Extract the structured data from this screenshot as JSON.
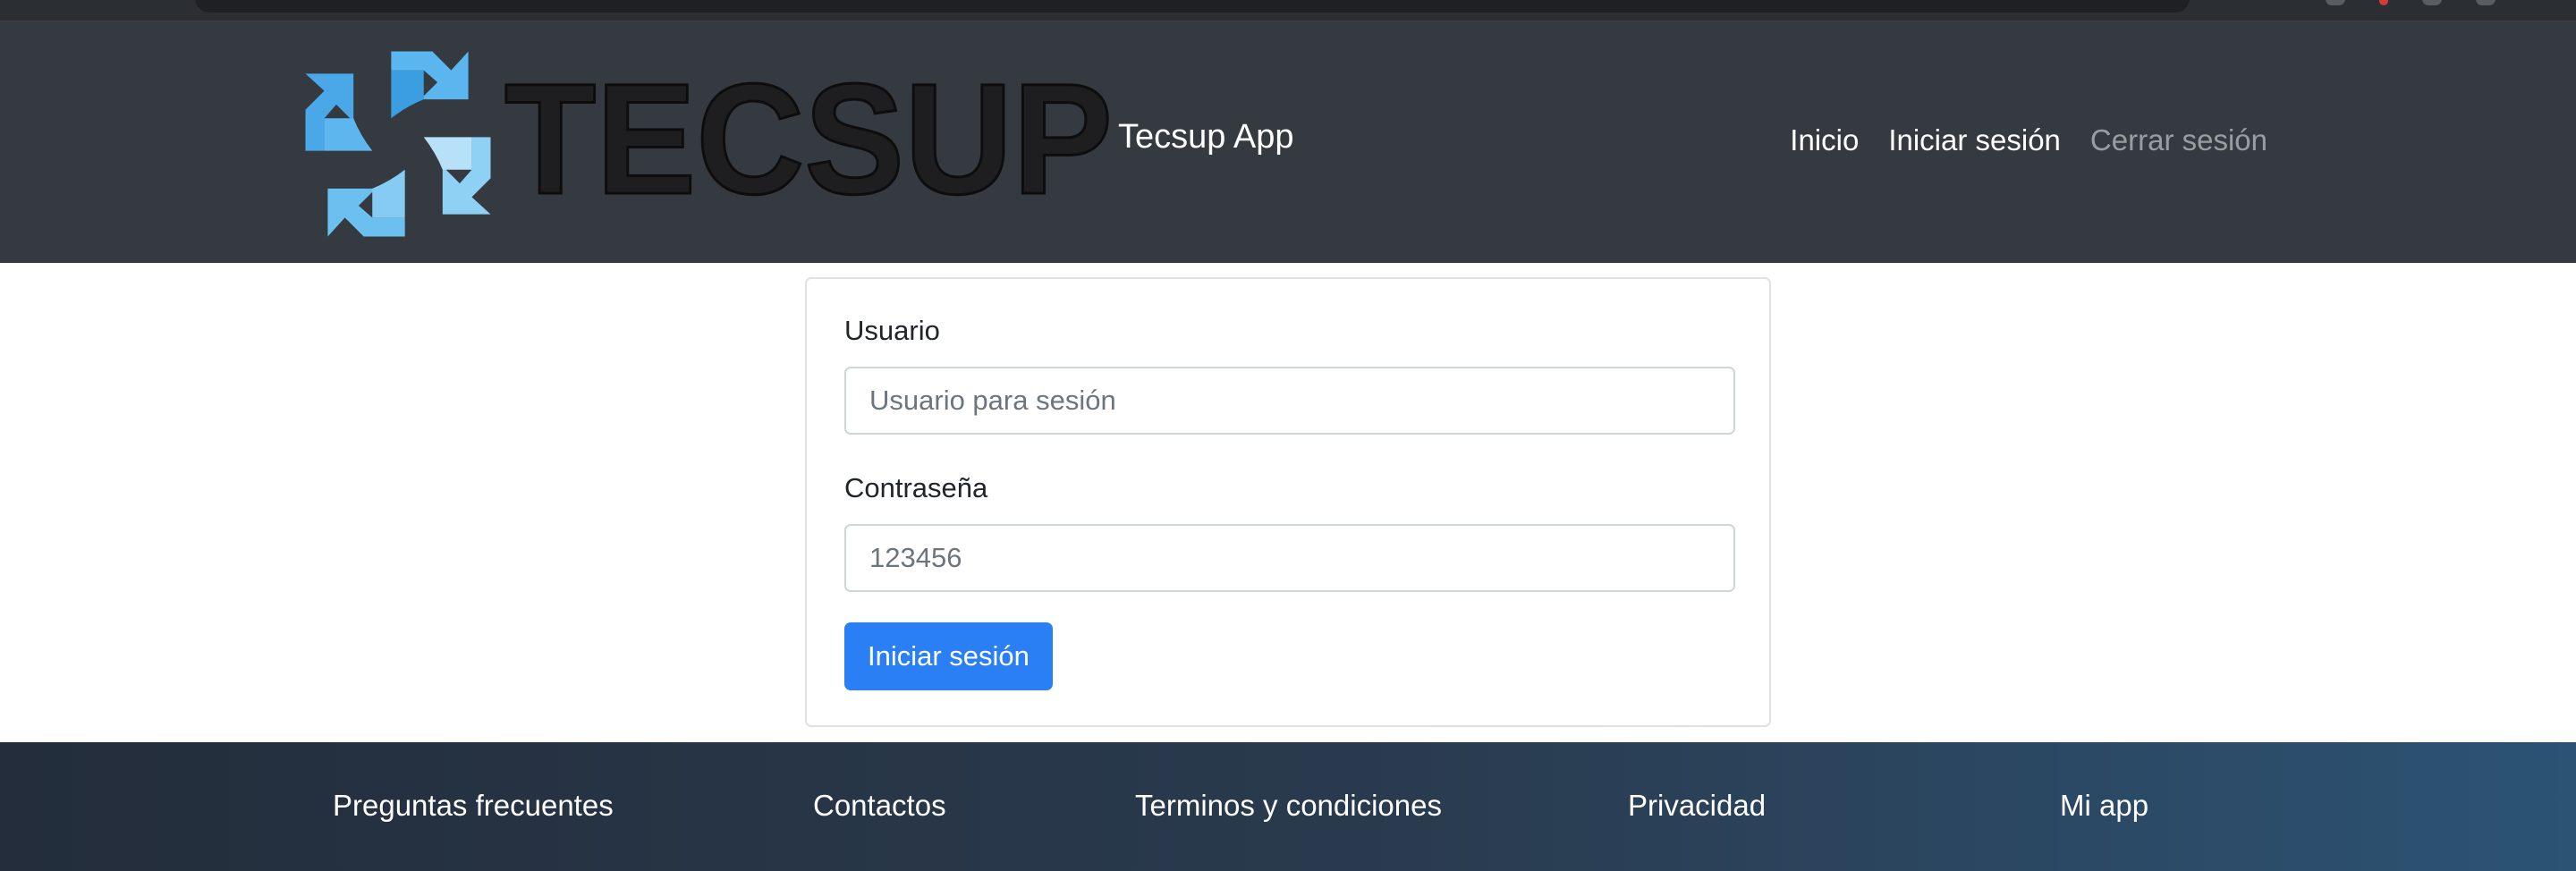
{
  "brand": {
    "logo_text": "TECSUP",
    "app_name": "Tecsup App"
  },
  "nav": {
    "items": [
      {
        "label": "Inicio"
      },
      {
        "label": "Iniciar sesión"
      },
      {
        "label": "Cerrar sesión",
        "disabled": true
      }
    ]
  },
  "login": {
    "username_label": "Usuario",
    "username_placeholder": "Usuario para sesión",
    "username_value": "",
    "password_label": "Contraseña",
    "password_placeholder": "123456",
    "password_value": "",
    "submit_label": "Iniciar sesión"
  },
  "footer": {
    "links": [
      {
        "label": "Preguntas frecuentes"
      },
      {
        "label": "Contactos"
      },
      {
        "label": "Terminos y condiciones"
      },
      {
        "label": "Privacidad"
      },
      {
        "label": "Mi app"
      }
    ]
  },
  "colors": {
    "navbar_bg": "#343a40",
    "primary": "#2b7ff5",
    "logo_blue": "#4aa8e8",
    "logo_dark": "#1e1e20"
  },
  "icons": {
    "logo": "tecsup-arrows-logo-icon"
  }
}
